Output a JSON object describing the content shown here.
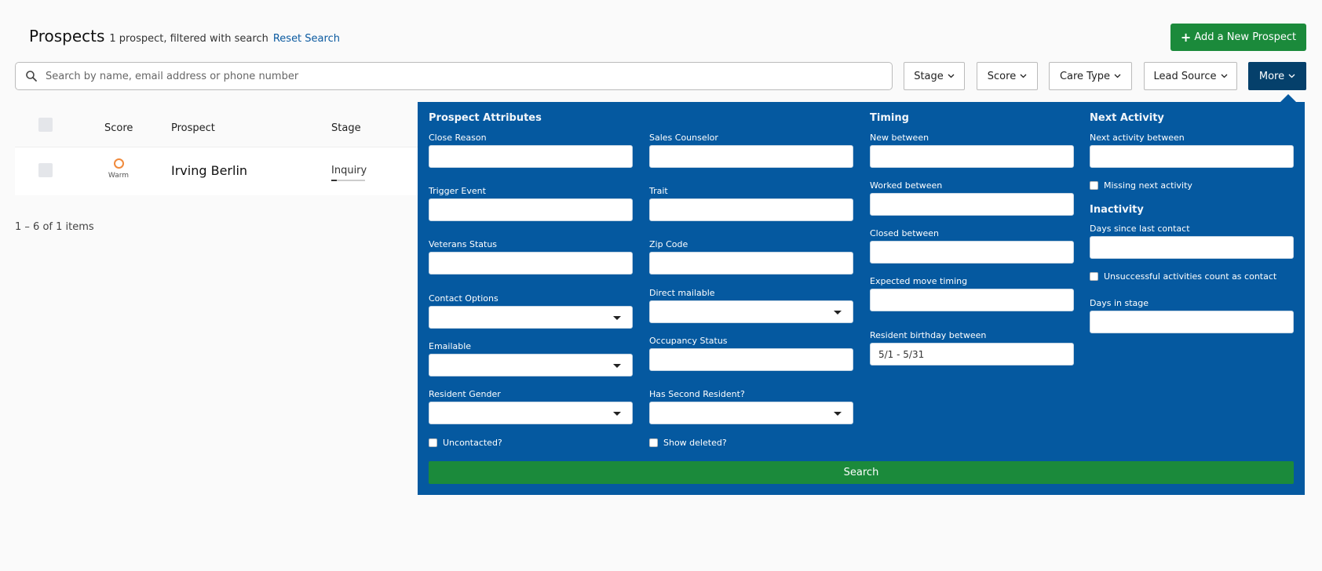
{
  "header": {
    "title": "Prospects",
    "subtitle": "1 prospect, filtered with search",
    "reset_link": "Reset Search",
    "add_button": "Add a New Prospect"
  },
  "search": {
    "placeholder": "Search by name, email address or phone number"
  },
  "filters": [
    {
      "label": "Stage"
    },
    {
      "label": "Score"
    },
    {
      "label": "Care Type"
    },
    {
      "label": "Lead Source"
    },
    {
      "label": "More"
    }
  ],
  "table": {
    "columns": [
      "Score",
      "Prospect",
      "Stage"
    ],
    "rows": [
      {
        "score": "Warm",
        "prospect": "Irving Berlin",
        "stage": "Inquiry"
      }
    ],
    "pager": "1 – 6 of 1 items"
  },
  "panel": {
    "sections": {
      "attributes": "Prospect Attributes",
      "timing": "Timing",
      "next_activity": "Next Activity",
      "inactivity": "Inactivity"
    },
    "fields": {
      "close_reason": "Close Reason",
      "sales_counselor": "Sales Counselor",
      "trigger_event": "Trigger Event",
      "trait": "Trait",
      "veterans_status": "Veterans Status",
      "zip_code": "Zip Code",
      "contact_options": "Contact Options",
      "direct_mailable": "Direct mailable",
      "emailable": "Emailable",
      "occupancy_status": "Occupancy Status",
      "resident_gender": "Resident Gender",
      "has_second_resident": "Has Second Resident?",
      "uncontacted": "Uncontacted?",
      "show_deleted": "Show deleted?",
      "new_between": "New between",
      "worked_between": "Worked between",
      "closed_between": "Closed between",
      "expected_move_timing": "Expected move timing",
      "resident_birthday_between": "Resident birthday between",
      "resident_birthday_value": "5/1 - 5/31",
      "next_activity_between": "Next activity between",
      "missing_next_activity": "Missing next activity",
      "days_since_last_contact": "Days since last contact",
      "unsuccessful_activities": "Unsuccessful activities count as contact",
      "days_in_stage": "Days in stage"
    },
    "search_button": "Search"
  },
  "colors": {
    "panel_bg": "#0559a0",
    "primary_green": "#1b8a3b",
    "more_active": "#05406b",
    "link": "#0b5aa0",
    "warm": "#f08a3c"
  }
}
